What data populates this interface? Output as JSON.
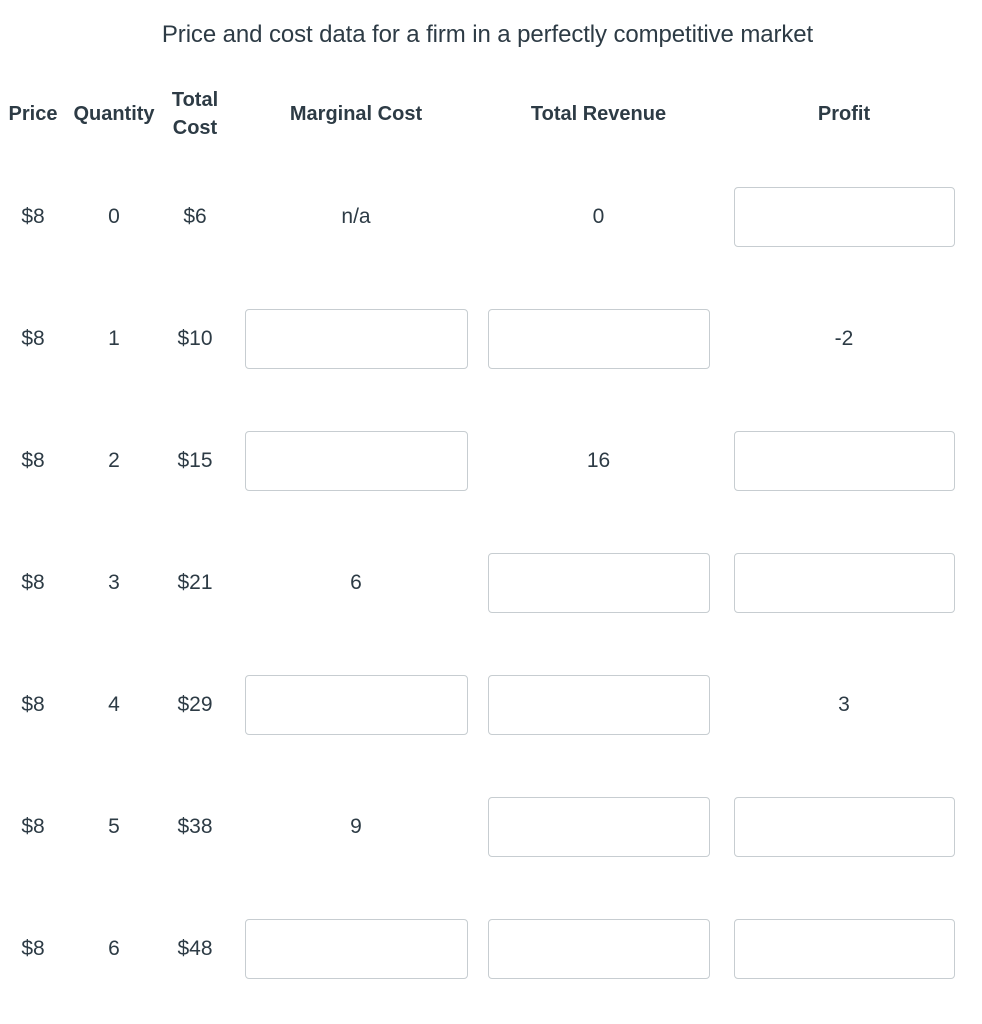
{
  "table": {
    "title": "Price and cost data for a firm in a perfectly competitive market",
    "columns": [
      {
        "key": "price",
        "label": "Price"
      },
      {
        "key": "quantity",
        "label": "Quantity"
      },
      {
        "key": "total_cost",
        "label": "Total Cost"
      },
      {
        "key": "marginal_cost",
        "label": "Marginal Cost"
      },
      {
        "key": "total_revenue",
        "label": "Total Revenue"
      },
      {
        "key": "profit",
        "label": "Profit"
      }
    ],
    "rows": [
      {
        "price": "$8",
        "quantity": "0",
        "total_cost": "$6",
        "marginal_cost": "n/a",
        "marginal_cost_input": false,
        "total_revenue": "0",
        "total_revenue_input": false,
        "profit": "",
        "profit_input": true
      },
      {
        "price": "$8",
        "quantity": "1",
        "total_cost": "$10",
        "marginal_cost": "",
        "marginal_cost_input": true,
        "total_revenue": "",
        "total_revenue_input": true,
        "profit": "-2",
        "profit_input": false
      },
      {
        "price": "$8",
        "quantity": "2",
        "total_cost": "$15",
        "marginal_cost": "",
        "marginal_cost_input": true,
        "total_revenue": "16",
        "total_revenue_input": false,
        "profit": "",
        "profit_input": true
      },
      {
        "price": "$8",
        "quantity": "3",
        "total_cost": "$21",
        "marginal_cost": "6",
        "marginal_cost_input": false,
        "total_revenue": "",
        "total_revenue_input": true,
        "profit": "",
        "profit_input": true
      },
      {
        "price": "$8",
        "quantity": "4",
        "total_cost": "$29",
        "marginal_cost": "",
        "marginal_cost_input": true,
        "total_revenue": "",
        "total_revenue_input": true,
        "profit": "3",
        "profit_input": false
      },
      {
        "price": "$8",
        "quantity": "5",
        "total_cost": "$38",
        "marginal_cost": "9",
        "marginal_cost_input": false,
        "total_revenue": "",
        "total_revenue_input": true,
        "profit": "",
        "profit_input": true
      },
      {
        "price": "$8",
        "quantity": "6",
        "total_cost": "$48",
        "marginal_cost": "",
        "marginal_cost_input": true,
        "total_revenue": "",
        "total_revenue_input": true,
        "profit": "",
        "profit_input": true
      }
    ]
  },
  "colors": {
    "text": "#2d3b45",
    "input_border": "#c7cdd1",
    "background": "#ffffff"
  }
}
